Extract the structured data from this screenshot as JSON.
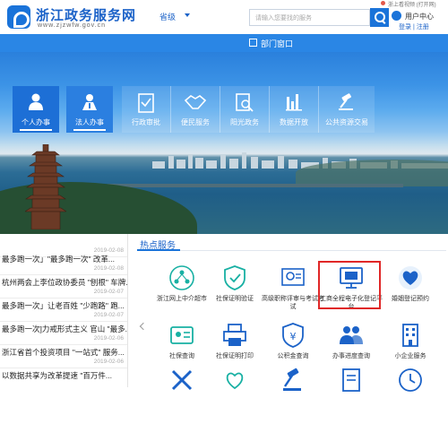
{
  "header": {
    "site_title": "浙江政务服务网",
    "site_url": "www.zjzwfw.gov.cn",
    "region": "省级",
    "search_placeholder": "请输入您要找的服务",
    "top_link": "浙上看视频 (打开网)",
    "user_label": "用户中心",
    "user_links": "登录 | 注册"
  },
  "nav": {
    "dept_window": "部门窗口"
  },
  "hero_tiles": [
    {
      "label": "个人办事",
      "icon": "person-icon"
    },
    {
      "label": "法人办事",
      "icon": "building-person-icon"
    },
    {
      "label": "行政审批",
      "icon": "checklist-icon"
    },
    {
      "label": "便民服务",
      "icon": "handshake-icon"
    },
    {
      "label": "阳光政务",
      "icon": "document-search-icon"
    },
    {
      "label": "数据开放",
      "icon": "bar-chart-icon"
    },
    {
      "label": "公共资源交易",
      "icon": "gavel-icon"
    }
  ],
  "news": [
    {
      "title": "",
      "date": "2019-02-08"
    },
    {
      "title": "最多跑一次」\"最多跑一次\" 改革...",
      "date": "2019-02-08"
    },
    {
      "title": "杭州两会上李位政协委员 \"刨根\" 车牌...",
      "date": "2019-02-07"
    },
    {
      "title": "最多跑一次」让老百姓 \"少跑路\" 跑...",
      "date": "2019-02-07"
    },
    {
      "title": "最多跑一次]力戒形式主义 官山 \"最多...",
      "date": "2019-02-06"
    },
    {
      "title": "浙江省首个投资项目 \"一站式\" 服务...",
      "date": "2019-02-06"
    },
    {
      "title": "以数据共享为改革提速 \"百万件...",
      "date": "2019-02-06"
    }
  ],
  "hot_services": {
    "title": "热点服务",
    "row1": [
      {
        "label": "浙江网上中介超市",
        "icon": "network-icon"
      },
      {
        "label": "社保证明验证",
        "icon": "shield-check-icon"
      },
      {
        "label": "高级职称评审与考试考试",
        "icon": "certificate-icon"
      },
      {
        "label": "工商全程电子化登记平台",
        "icon": "monitor-icon"
      },
      {
        "label": "婚姻登记预约",
        "icon": "heart-icon"
      }
    ],
    "row2": [
      {
        "label": "社保查询",
        "icon": "id-card-icon"
      },
      {
        "label": "社保证明打印",
        "icon": "printer-icon"
      },
      {
        "label": "公积金查询",
        "icon": "shield-money-icon"
      },
      {
        "label": "办事进度查询",
        "icon": "people-icon"
      },
      {
        "label": "小企业服务",
        "icon": "office-icon"
      }
    ],
    "row3": [
      {
        "label": "",
        "icon": "tools-icon"
      },
      {
        "label": "",
        "icon": "heart-hand-icon"
      },
      {
        "label": "",
        "icon": "gavel-icon"
      },
      {
        "label": "",
        "icon": "document-icon"
      },
      {
        "label": "",
        "icon": "clock-icon"
      }
    ]
  },
  "colors": {
    "brand": "#1a73d9",
    "highlight": "#e02727",
    "accent_teal": "#18b0a3"
  }
}
